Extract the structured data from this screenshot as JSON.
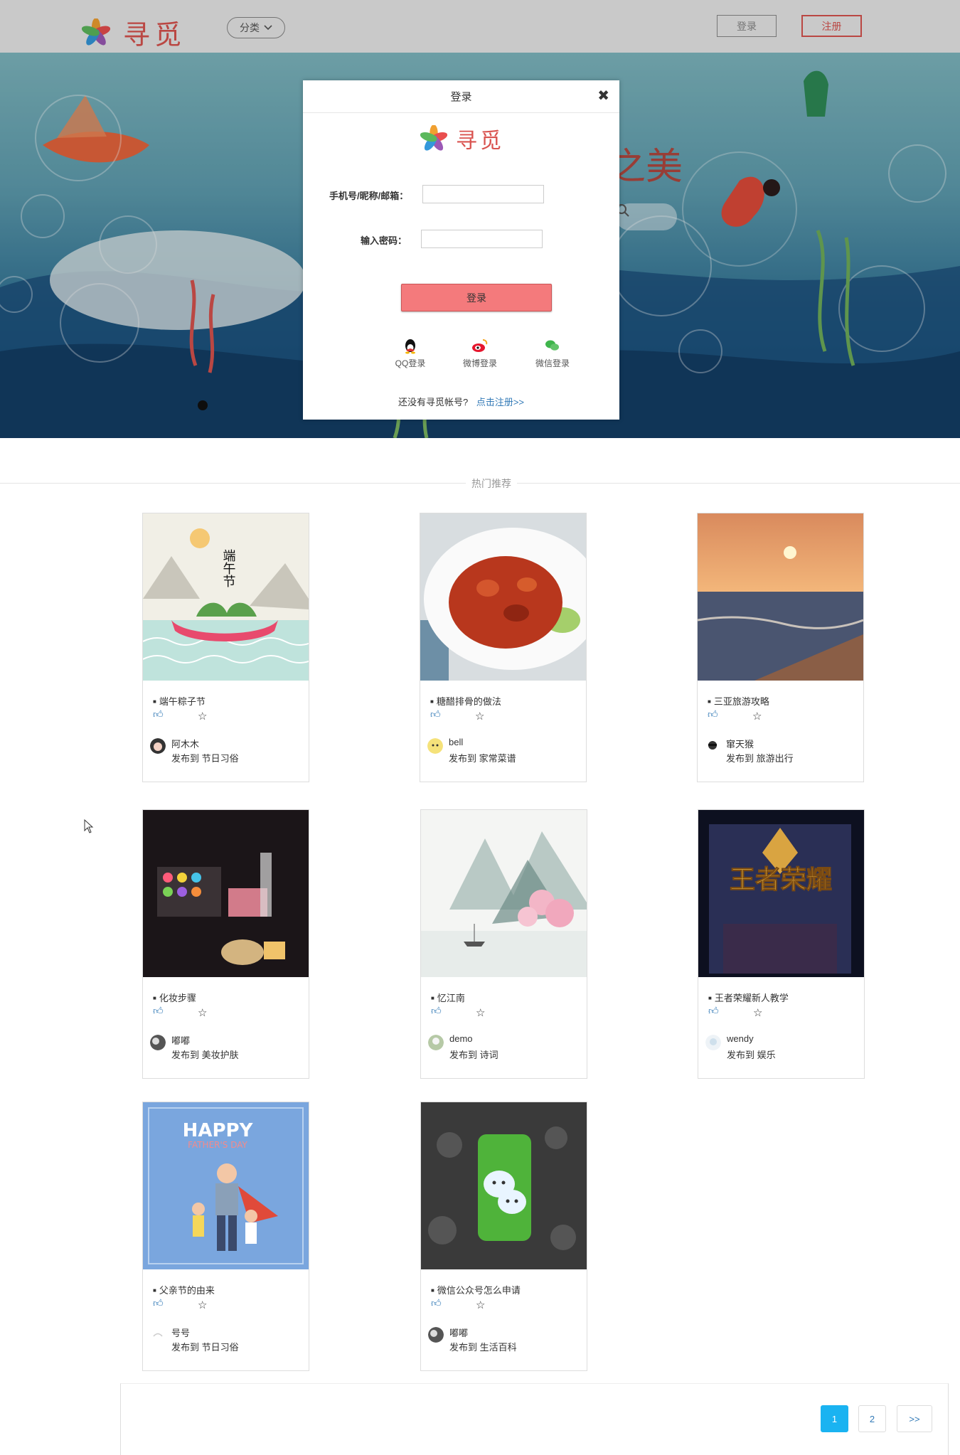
{
  "header": {
    "brand": "寻觅",
    "category_label": "分类",
    "login_label": "登录",
    "register_label": "注册"
  },
  "banner": {
    "slogan_fragment": "之美"
  },
  "login_modal": {
    "title": "登录",
    "close": "✖",
    "brand": "寻觅",
    "account_label": "手机号/昵称/邮箱：",
    "account_value": "",
    "password_label": "输入密码：",
    "password_value": "",
    "submit_label": "登录",
    "social": {
      "qq": "QQ登录",
      "weibo": "微博登录",
      "wechat": "微信登录"
    },
    "footer_text": "还没有寻觅帐号?",
    "footer_link": "点击注册>>"
  },
  "section": {
    "title": "热门推荐"
  },
  "posts": [
    {
      "title": "端午粽子节",
      "author": "阿木木",
      "posted": "发布到 节日习俗"
    },
    {
      "title": "糖醋排骨的做法",
      "author": "bell",
      "posted": "发布到 家常菜谱"
    },
    {
      "title": "三亚旅游攻略",
      "author": "窜天猴",
      "posted": "发布到 旅游出行"
    },
    {
      "title": "化妆步骤",
      "author": "嘟嘟",
      "posted": "发布到 美妆护肤"
    },
    {
      "title": "忆江南",
      "author": "demo",
      "posted": "发布到 诗词"
    },
    {
      "title": "王者荣耀新人教学",
      "author": "wendy",
      "posted": "发布到 娱乐"
    },
    {
      "title": "父亲节的由来",
      "author": "号号",
      "posted": "发布到 节日习俗"
    },
    {
      "title": "微信公众号怎么申请",
      "author": "嘟嘟",
      "posted": "发布到 生活百科"
    }
  ],
  "image_text": {
    "dragon_boat": "端午节",
    "fathers_day_1": "HAPPY",
    "fathers_day_2": "FATHER'S DAY",
    "game_logo": "王者荣耀"
  },
  "icons": {
    "like": "thumbs-up-icon",
    "favorite": "star-icon"
  },
  "pagination": {
    "pages": [
      "1",
      "2"
    ],
    "next": ">>",
    "current": "1"
  },
  "colors": {
    "brand_red": "#d9534f",
    "submit_pink": "#f47a7c",
    "page_active": "#1ab3f1",
    "link_blue": "#337ab7"
  }
}
